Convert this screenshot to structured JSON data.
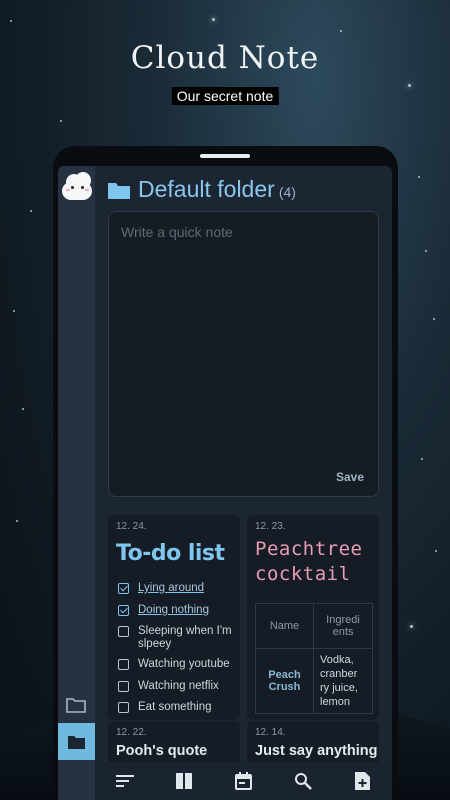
{
  "app": {
    "title": "Cloud Note",
    "subtitle": "Our secret note"
  },
  "folder": {
    "name": "Default folder",
    "count": "(4)"
  },
  "quick_note": {
    "placeholder": "Write a quick note",
    "save_label": "Save"
  },
  "notes": [
    {
      "date": "12. 24.",
      "title": "To-do list",
      "items": [
        {
          "text": "Lying around",
          "checked": true
        },
        {
          "text": "Doing nothing",
          "checked": true
        },
        {
          "text": "Sleeping when I'm slpeey",
          "checked": false
        },
        {
          "text": "Watching youtube",
          "checked": false
        },
        {
          "text": "Watching netflix",
          "checked": false
        },
        {
          "text": "Eat something",
          "checked": false
        }
      ]
    },
    {
      "date": "12. 23.",
      "title": "Peachtree cocktail",
      "table": {
        "headers": [
          "Name",
          "Ingredi ents"
        ],
        "row": [
          "Peach Crush",
          "Vodka, cranber ry juice, lemon"
        ]
      }
    },
    {
      "date": "12. 22.",
      "title": "Pooh's quote"
    },
    {
      "date": "12. 14.",
      "title": "Just say anything"
    }
  ],
  "bottom_nav": [
    "sort-icon",
    "book-icon",
    "calendar-icon",
    "search-icon",
    "new-note-icon"
  ],
  "colors": {
    "accent": "#7fc6ef",
    "rail_active": "#6fb8de",
    "peach": "#e99db4",
    "background": "#1c2633"
  }
}
